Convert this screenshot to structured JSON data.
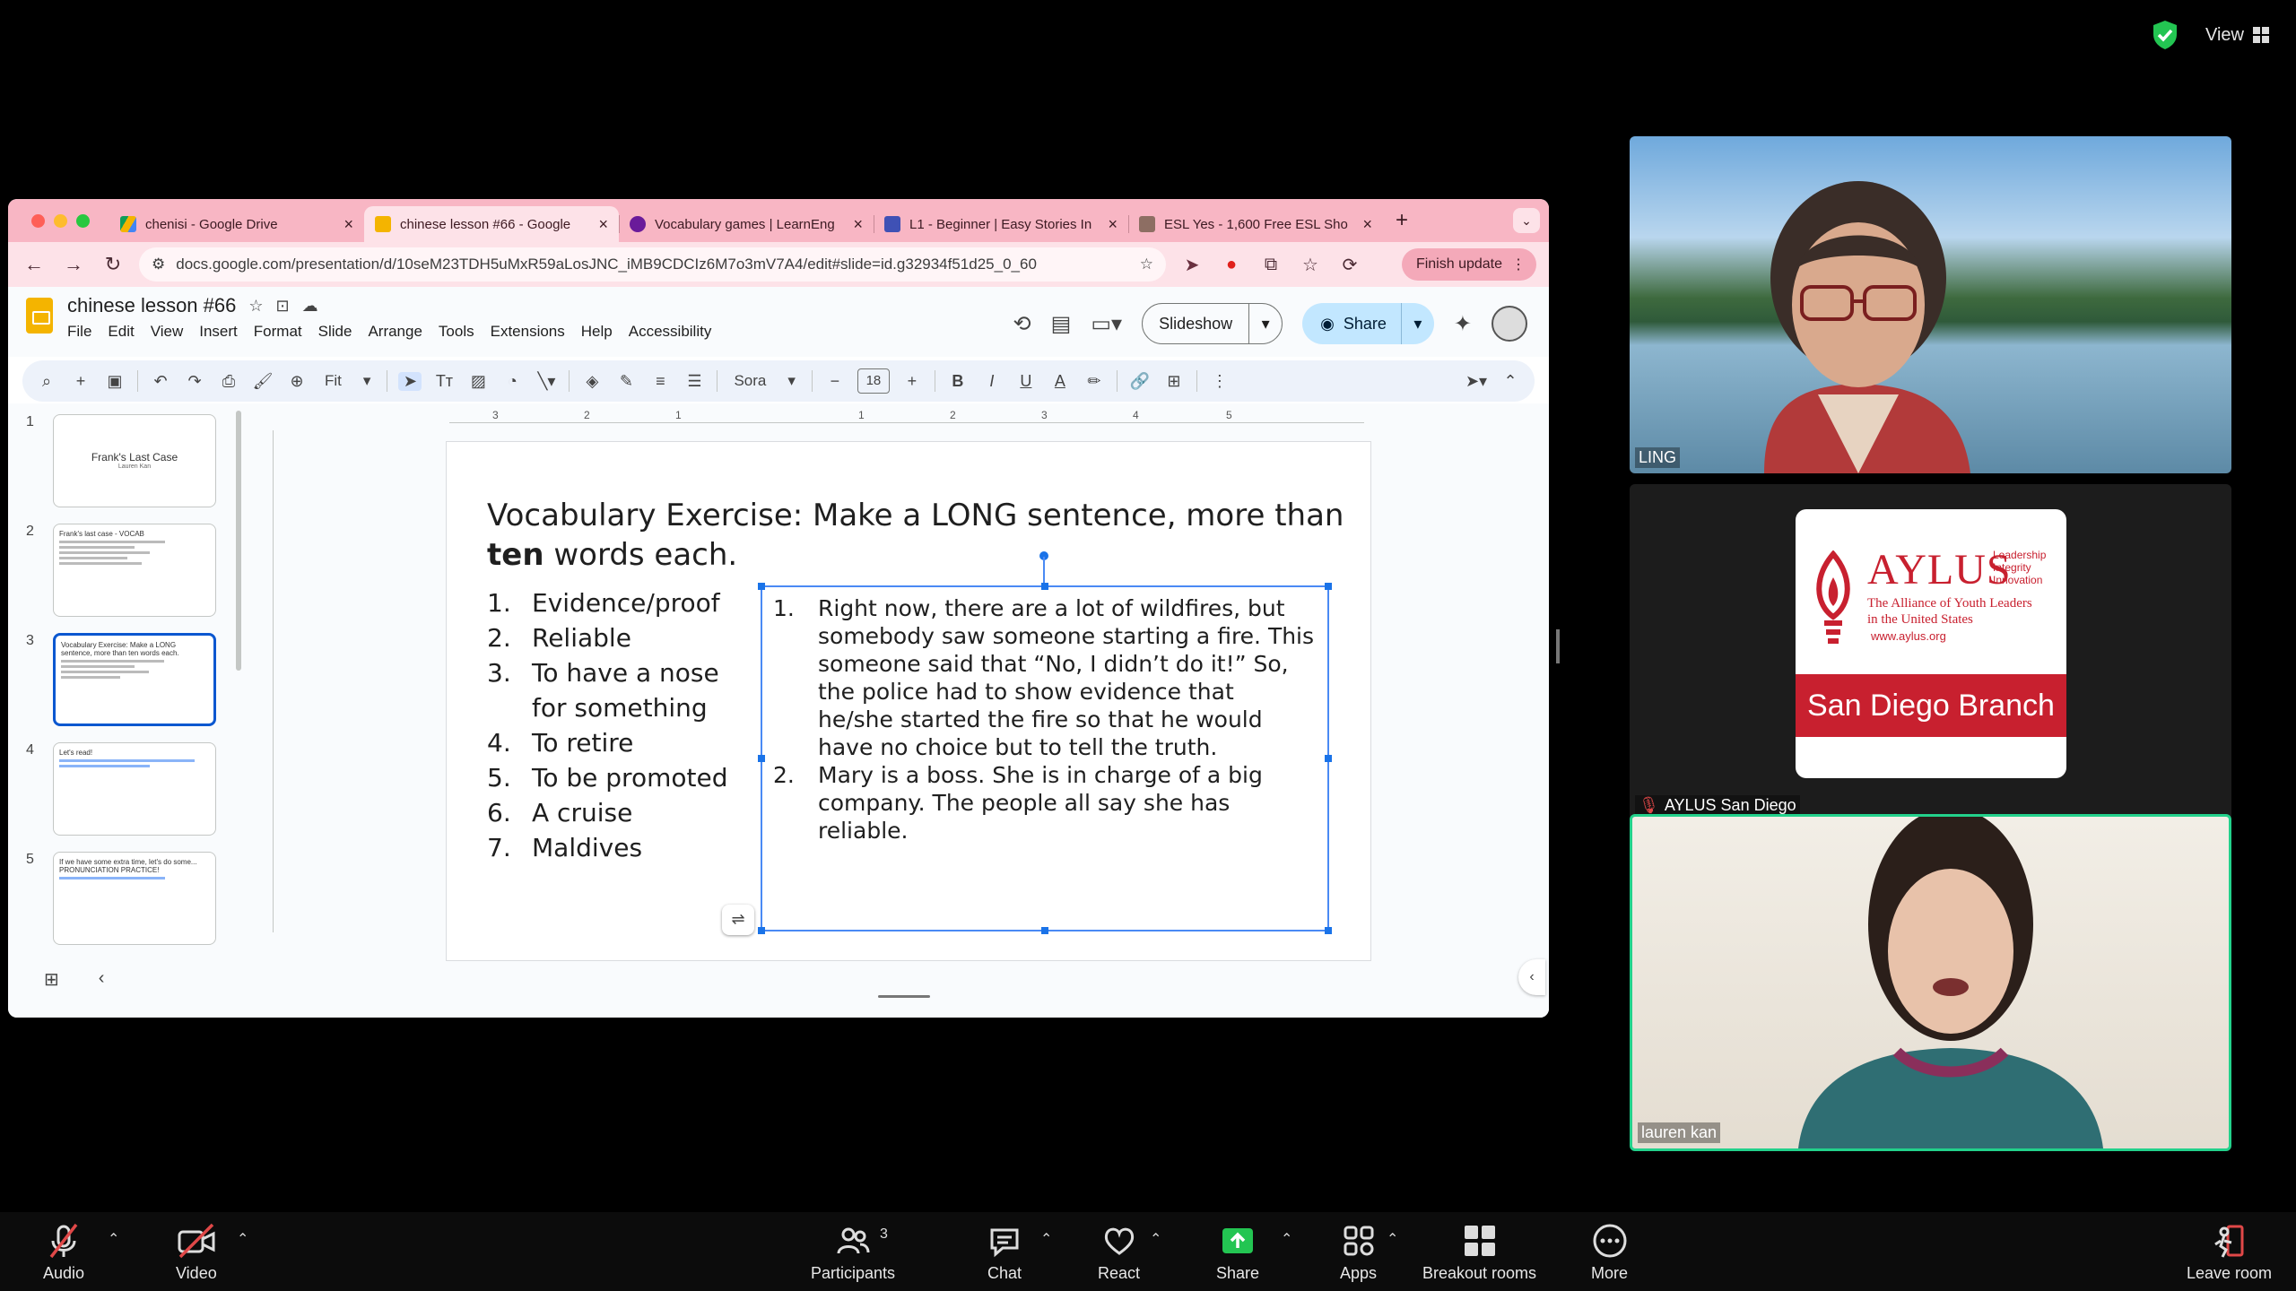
{
  "zoom": {
    "view_label": "View",
    "toolbar": {
      "audio": "Audio",
      "video": "Video",
      "participants": "Participants",
      "participants_count": "3",
      "chat": "Chat",
      "react": "React",
      "share": "Share",
      "apps": "Apps",
      "breakout": "Breakout rooms",
      "more": "More",
      "leave": "Leave room"
    },
    "tiles": [
      {
        "name": "LING"
      },
      {
        "name": "AYLUS San Diego"
      },
      {
        "name": "lauren kan"
      }
    ],
    "aylus": {
      "brand": "AYLUS",
      "tagline": [
        "Leadership",
        "Integrity",
        "Innovation"
      ],
      "alliance": [
        "The Alliance of Youth Leaders",
        "in the United States"
      ],
      "url": "www.aylus.org",
      "branch": "San Diego Branch"
    }
  },
  "browser": {
    "tabs": [
      {
        "title": "chenisi - Google Drive",
        "color": "#4285f4"
      },
      {
        "title": "chinese lesson #66 - Google",
        "color": "#f4b400"
      },
      {
        "title": "Vocabulary games | LearnEng",
        "color": "#6a1b9a"
      },
      {
        "title": "L1 - Beginner | Easy Stories In",
        "color": "#3f51b5"
      },
      {
        "title": "ESL Yes - 1,600 Free ESL Sho",
        "color": "#8d6e63"
      }
    ],
    "url": "docs.google.com/presentation/d/10seM23TDH5uMxR59aLosJNC_iMB9CDCIz6M7o3mV7A4/edit#slide=id.g32934f51d25_0_60",
    "finish_update": "Finish update"
  },
  "slides_app": {
    "doc_title": "chinese lesson #66",
    "menus": [
      "File",
      "Edit",
      "View",
      "Insert",
      "Format",
      "Slide",
      "Arrange",
      "Tools",
      "Extensions",
      "Help",
      "Accessibility"
    ],
    "slideshow_label": "Slideshow",
    "share_label": "Share",
    "zoom_value": "Fit",
    "font_name": "Sora",
    "font_size": "18",
    "ruler_ticks": [
      "3",
      "2",
      "1",
      "1",
      "2",
      "3",
      "4",
      "5"
    ],
    "thumbnails": [
      {
        "num": "1",
        "title": "Frank's Last Case",
        "sub": "Lauren Kan"
      },
      {
        "num": "2",
        "title": "Frank's last case - VOCAB"
      },
      {
        "num": "3",
        "title": "Vocabulary Exercise: Make a LONG sentence, more than ten words each."
      },
      {
        "num": "4",
        "title": "Let's read!"
      },
      {
        "num": "5",
        "title": "If we have some extra time, let's do some... PRONUNCIATION PRACTICE!"
      }
    ]
  },
  "slide": {
    "title_a": "Vocabulary Exercise: Make a LONG sentence, more than ",
    "title_bold": "ten",
    "title_b": " words each.",
    "vocab": [
      {
        "n": "1.",
        "t": "Evidence/proof"
      },
      {
        "n": "2.",
        "t": "Reliable"
      },
      {
        "n": "3.",
        "t": "To have a nose for something"
      },
      {
        "n": "4.",
        "t": "To retire"
      },
      {
        "n": "5.",
        "t": "To be promoted"
      },
      {
        "n": "6.",
        "t": "A cruise"
      },
      {
        "n": "7.",
        "t": "Maldives"
      }
    ],
    "answers": [
      {
        "n": "1.",
        "t": "Right now, there are a lot of wildfires, but somebody saw someone starting a fire. This someone said that “No, I didn’t do it!” So, the police had to show evidence that he/she started the fire so that he would have no choice but to tell the truth."
      },
      {
        "n": "2.",
        "t": "Mary is a boss. She is in charge of a big company. The people all say she has reliable."
      }
    ]
  }
}
